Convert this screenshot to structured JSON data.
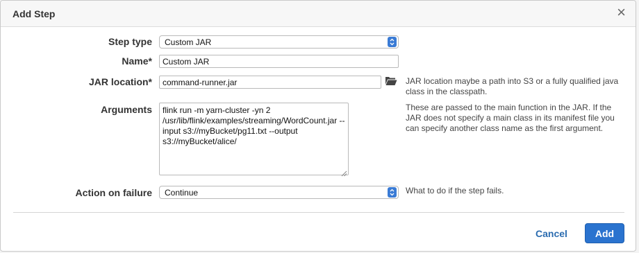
{
  "dialog": {
    "title": "Add Step",
    "close_glyph": "×"
  },
  "form": {
    "step_type": {
      "label": "Step type",
      "value": "Custom JAR"
    },
    "name": {
      "label": "Name*",
      "value": "Custom JAR"
    },
    "jar_location": {
      "label": "JAR location*",
      "value": "command-runner.jar",
      "help": "JAR location maybe a path into S3 or a fully qualified java class in the classpath."
    },
    "arguments": {
      "label": "Arguments",
      "value": "flink run -m yarn-cluster -yn 2 /usr/lib/flink/examples/streaming/WordCount.jar --input s3://myBucket/pg11.txt --output s3://myBucket/alice/",
      "help": "These are passed to the main function in the JAR. If the JAR does not specify a main class in its manifest file you can specify another class name as the first argument."
    },
    "action_on_failure": {
      "label": "Action on failure",
      "value": "Continue",
      "help": "What to do if the step fails."
    }
  },
  "footer": {
    "cancel_label": "Cancel",
    "add_label": "Add"
  },
  "colors": {
    "primary": "#2a73cf",
    "link": "#2b6cb0"
  }
}
